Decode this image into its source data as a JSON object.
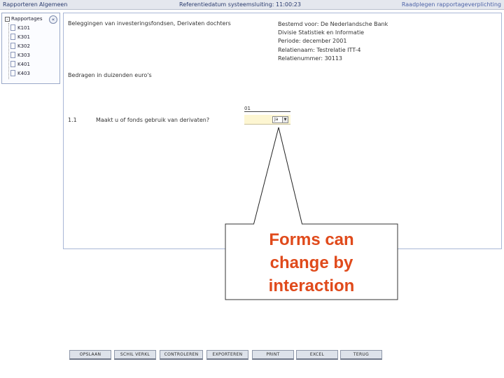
{
  "menu": {
    "items": [
      "Rapporteren",
      "Algemeen"
    ],
    "reference_date": "Referentiedatum systeemsluiting: 11:00:23",
    "consult_link": "Raadplegen rapportageverplichting"
  },
  "tree": {
    "root_label": "Rapportages",
    "collapse_label": "«",
    "items": [
      "K101",
      "K301",
      "K302",
      "K303",
      "K401",
      "K403"
    ]
  },
  "form": {
    "title": "Beleggingen van investeringsfondsen, Derivaten dochters",
    "info_lines": [
      "Bestemd voor: De Nederlandsche Bank",
      "Divisie Statistiek en Informatie",
      "Periode: december 2001",
      "Relatienaam: Testrelatie ITT-4",
      "Relatienummer: 30113"
    ],
    "amount_note": "Bedragen in duizenden euro's",
    "column_code": "01",
    "question_number": "1.1",
    "question_label": "Maakt u of fonds gebruik van derivaten?",
    "answer_value": "Ja"
  },
  "callout": {
    "lines": [
      "Forms can",
      "change by",
      "interaction"
    ],
    "color": "#e04a1b"
  },
  "buttons": [
    "OPSLAAN",
    "SCHIL VERKL",
    "CONTROLEREN",
    "EXPORTEREN",
    "PRINT",
    "EXCEL",
    "TERUG"
  ]
}
